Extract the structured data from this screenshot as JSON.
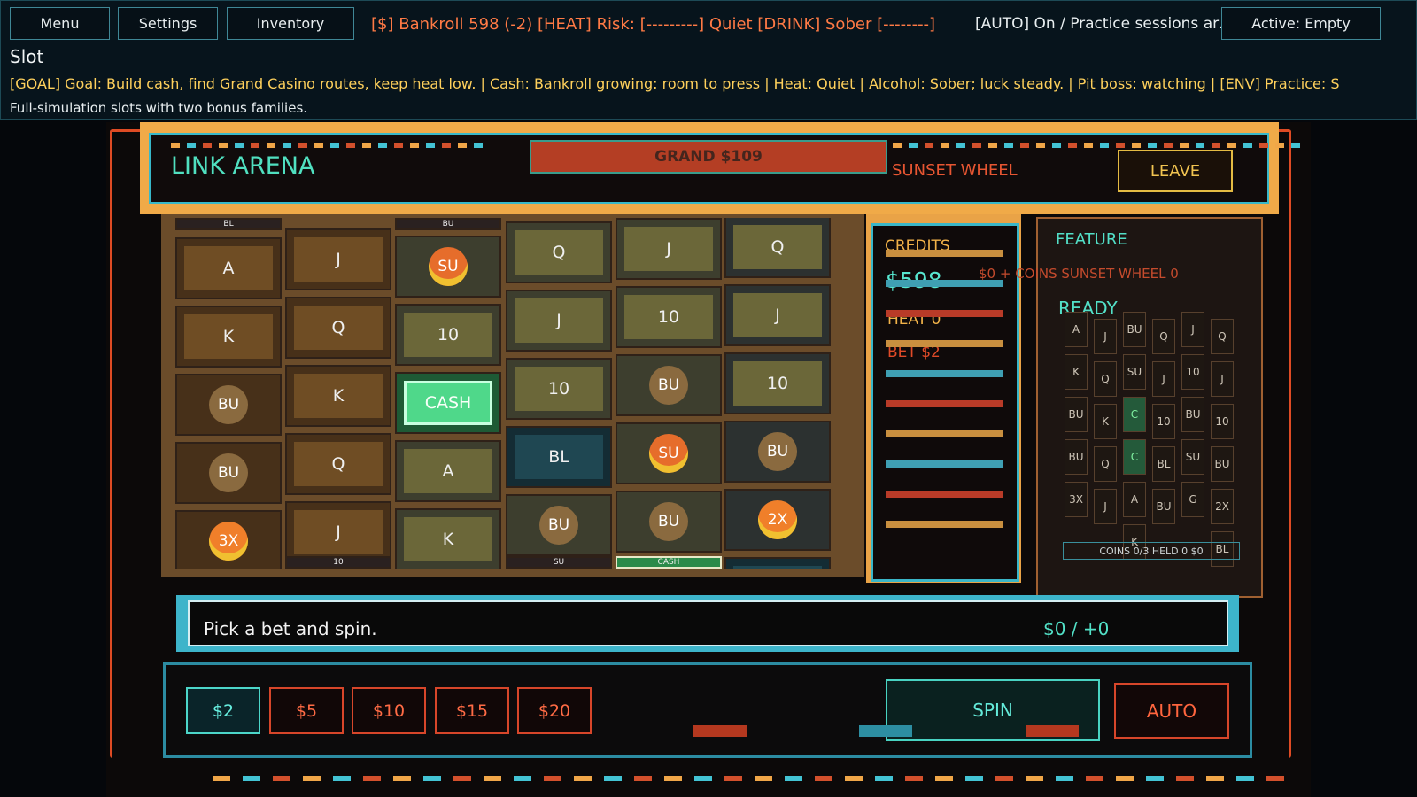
{
  "topbar": {
    "menu": "Menu",
    "settings": "Settings",
    "inventory": "Inventory",
    "status": "[$] Bankroll 598 (-2)  [HEAT] Risk: [---------] Quiet  [DRINK] Sober [--------] L",
    "auto": "[AUTO] On / Practice sessions are...",
    "active": "Active: Empty",
    "title": "Slot",
    "goal": "[GOAL] Goal: Build cash, find Grand Casino routes, keep heat low. | Cash: Bankroll growing: room to press | Heat: Quiet | Alcohol: Sober; luck steady. | Pit boss: watching | [ENV] Practice: S",
    "description": "Full-simulation slots with two bonus families."
  },
  "machine": {
    "name": "LINK ARENA",
    "grand": "GRAND $109",
    "bonus_name": "SUNSET WHEEL",
    "leave": "LEAVE"
  },
  "reels": [
    {
      "top_label": "BL",
      "symbols": [
        "A",
        "K",
        "BU",
        "BU",
        "3X"
      ]
    },
    {
      "top_label": "",
      "symbols": [
        "J",
        "Q",
        "K",
        "Q",
        "J"
      ],
      "bottom_label": "10"
    },
    {
      "top_label": "BU",
      "symbols": [
        "SU",
        "10",
        "CASH",
        "A",
        "K"
      ]
    },
    {
      "top_label": "",
      "symbols": [
        "Q",
        "J",
        "10",
        "BL",
        "BU"
      ],
      "bottom_label": "SU"
    },
    {
      "top_label": "",
      "symbols": [
        "J",
        "10",
        "BU",
        "SU",
        "BU"
      ],
      "bottom_label": "CASH"
    },
    {
      "top_label": "",
      "symbols": [
        "Q",
        "J",
        "10",
        "BU",
        "2X",
        "BL"
      ]
    }
  ],
  "stats": {
    "credits_label": "CREDITS",
    "credits": "$598",
    "heat": "HEAT 0",
    "bet": "BET $2"
  },
  "feature": {
    "label": "FEATURE",
    "overlay": "$0 + COINS SUNSET WHEEL 0",
    "ready": "READY",
    "coins": "COINS 0/3  HELD 0  $0",
    "mini_cols": [
      [
        "A",
        "K",
        "BU",
        "BU",
        "3X"
      ],
      [
        "J",
        "Q",
        "K",
        "Q",
        "J"
      ],
      [
        "BU",
        "SU",
        "C",
        "C",
        "A",
        "K"
      ],
      [
        "Q",
        "J",
        "10",
        "BL",
        "BU"
      ],
      [
        "J",
        "10",
        "BU",
        "SU",
        "G"
      ],
      [
        "Q",
        "J",
        "10",
        "BU",
        "2X",
        "BL"
      ]
    ]
  },
  "message": {
    "text": "Pick a bet and spin.",
    "win": "$0 / +0"
  },
  "bets": [
    "$2",
    "$5",
    "$10",
    "$15",
    "$20"
  ],
  "selected_bet": "$2",
  "controls": {
    "spin": "SPIN",
    "auto": "AUTO"
  }
}
